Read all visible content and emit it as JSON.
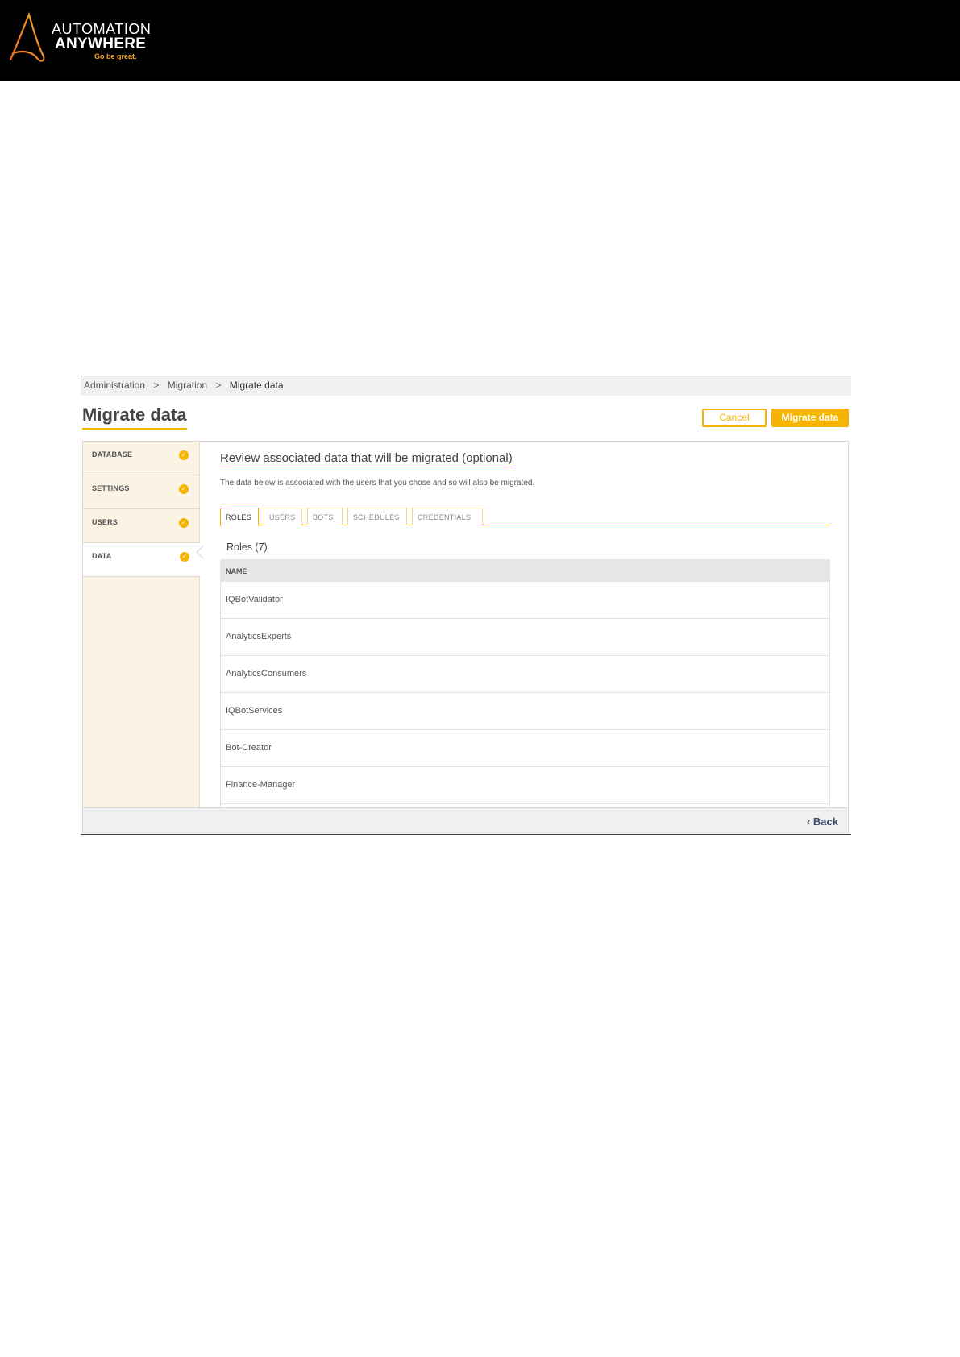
{
  "brand": {
    "line1": "AUTOMATION",
    "line2": "ANYWHERE",
    "tagline": "Go be great.",
    "accent_color": "#f5a623",
    "icon": "automation-anywhere-logo"
  },
  "breadcrumb": {
    "items": [
      "Administration",
      "Migration",
      "Migrate data"
    ],
    "separator": ">"
  },
  "page": {
    "title": "Migrate data",
    "cancel_label": "Cancel",
    "migrate_label": "Migrate data",
    "accent_color": "#f5b400"
  },
  "steps": [
    {
      "label": "DATABASE",
      "icon": "check-circle-icon"
    },
    {
      "label": "SETTINGS",
      "icon": "check-circle-icon"
    },
    {
      "label": "USERS",
      "icon": "check-circle-icon"
    },
    {
      "label": "DATA",
      "icon": "check-circle-icon",
      "active": true
    }
  ],
  "review": {
    "title": "Review associated data that will be migrated (optional)",
    "description": "The data below is associated with the users that you chose and so will also be migrated."
  },
  "tabs": [
    {
      "label": "ROLES",
      "active": true
    },
    {
      "label": "USERS"
    },
    {
      "label": "BOTS"
    },
    {
      "label": "SCHEDULES"
    },
    {
      "label": "CREDENTIALS"
    }
  ],
  "roles": {
    "count_label": "Roles (7)",
    "column_header": "NAME",
    "rows": [
      "IQBotValidator",
      "AnalyticsExperts",
      "AnalyticsConsumers",
      "IQBotServices",
      "Bot-Creator",
      "Finance-Manager"
    ]
  },
  "footer": {
    "back_label": "Back",
    "back_icon": "chevron-left-icon"
  }
}
